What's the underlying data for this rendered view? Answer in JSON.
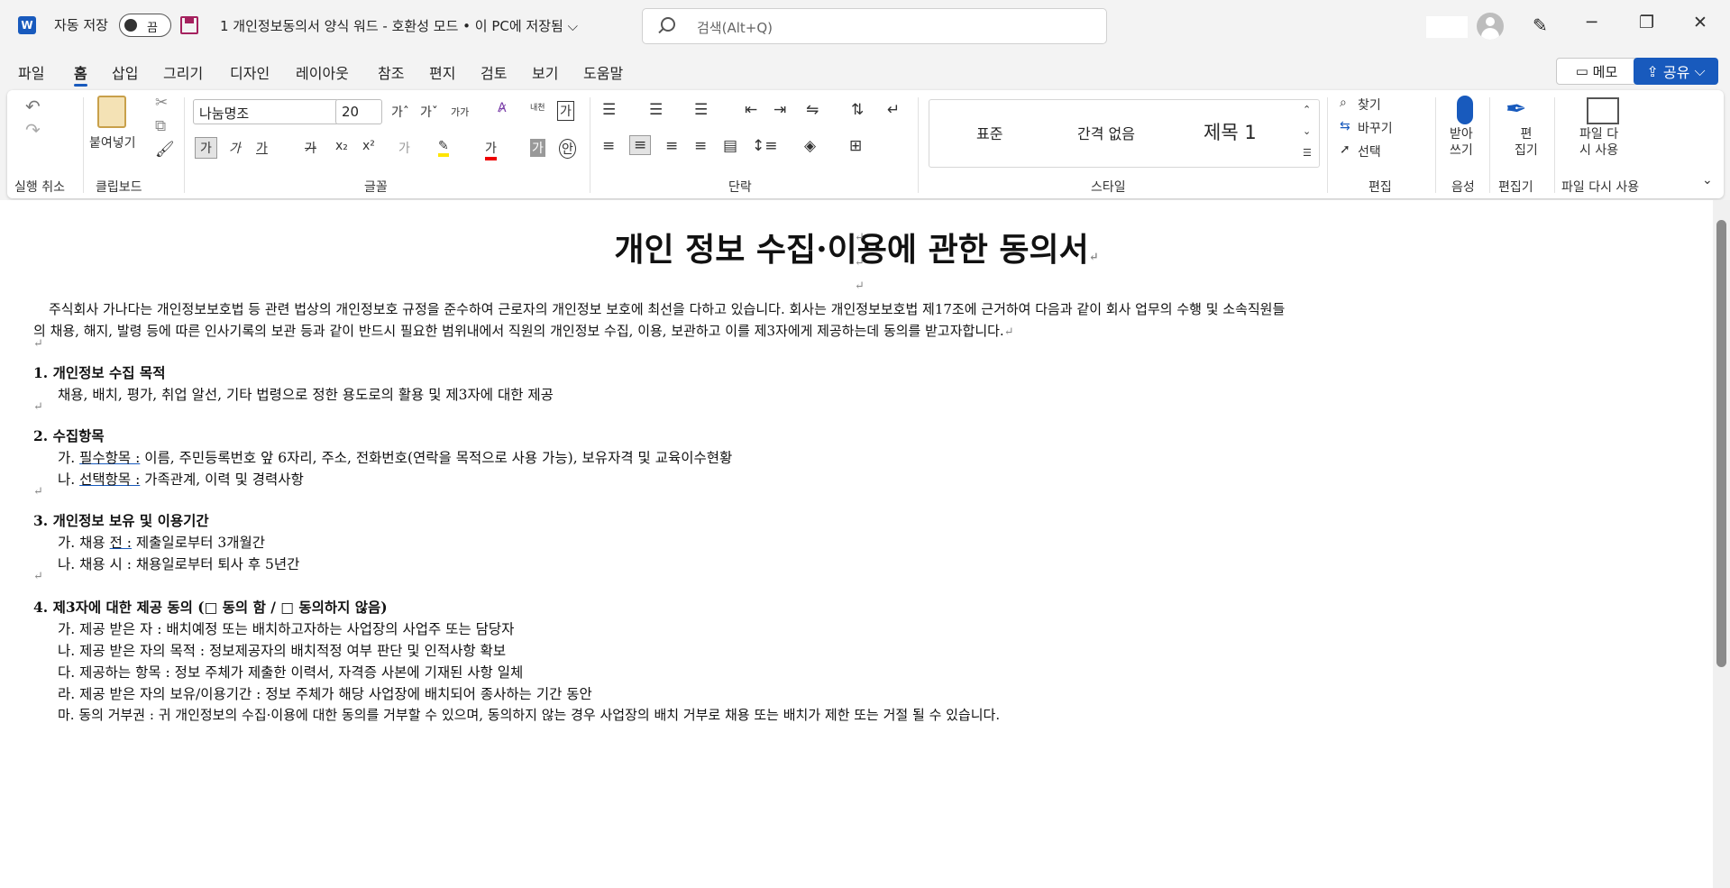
{
  "titlebar": {
    "autosave": "자동 저장",
    "toggle": "끔",
    "doc_title": "1 개인정보동의서 양식 워드 - 호환성 모드 • 이 PC에 저장됨 ⌵",
    "search_placeholder": "검색(Alt+Q)",
    "minimize": "─",
    "restore": "❐",
    "close": "✕"
  },
  "tabs": [
    "파일",
    "홈",
    "삽입",
    "그리기",
    "디자인",
    "레이아웃",
    "참조",
    "편지",
    "검토",
    "보기",
    "도움말"
  ],
  "memo": "메모",
  "share": "공유",
  "ribbon": {
    "groups": {
      "undo": "실행 취소",
      "clipboard": "클립보드",
      "font": "글꼴",
      "paragraph": "단락",
      "styles": "스타일",
      "editing": "편집",
      "voice": "음성",
      "editor": "편집기",
      "reuse": "파일 다시 사용"
    },
    "paste": "붙여넣기",
    "font_name": "나눔명조",
    "font_size": "20",
    "styles": [
      "표준",
      "간격 없음",
      "제목 1"
    ],
    "find": "찾기",
    "replace": "바꾸기",
    "select": "선택",
    "dictate": "받아\n쓰기",
    "editor_btn": "편\n집기",
    "reuse_btn": "파일 다\n시 사용"
  },
  "document": {
    "title": "개인 정보 수집·이용에 관한 동의서",
    "intro1": "주식회사 가나다는 개인정보보호법 등 관련 법상의 개인정보호 규정을 준수하여 근로자의 개인정보 보호에 최선을 다하고 있습니다. 회사는 개인정보보호법 제17조에 근거하여 다음과 같이 회사 업무의 수행 및 소속직원들",
    "intro2": "의 채용, 해지, 발령 등에 따른 인사기록의 보관 등과 같이 반드시 필요한 범위내에서 직원의 개인정보 수집, 이용, 보관하고 이를 제3자에게 제공하는데 동의를 받고자합니다.",
    "s1": "1. 개인정보 수집 목적",
    "s1a": "채용, 배치, 평가, 취업 알선, 기타 법령으로 정한 용도로의 활용 및 제3자에 대한 제공",
    "s2": "2. 수집항목",
    "s2a_pre": "가. ",
    "s2a_u": "필수항목 :",
    "s2a": " 이름, 주민등록번호 앞 6자리, 주소, 전화번호(연락을 목적으로 사용 가능), 보유자격 및 교육이수현황",
    "s2b_pre": "나. ",
    "s2b_u": "선택항목 :",
    "s2b": " 가족관계, 이력 및 경력사항",
    "s3": "3. 개인정보 보유 및 이용기간",
    "s3a_pre": "가. 채용 ",
    "s3a_u": "전 :",
    "s3a": " 제출일로부터 3개월간",
    "s3b": "나. 채용 시 : 채용일로부터 퇴사 후 5년간",
    "s4": "4. 제3자에 대한 제공 동의 (□ 동의 함 / □ 동의하지 않음)",
    "s4a": "가. 제공 받은 자 : 배치예정 또는 배치하고자하는 사업장의 사업주 또는 담당자",
    "s4b": "나. 제공 받은 자의 목적 : 정보제공자의 배치적정 여부 판단 및 인적사항 확보",
    "s4c": "다. 제공하는 항목 : 정보 주체가 제출한 이력서, 자격증 사본에 기재된 사항 일체",
    "s4d": "라. 제공 받은 자의 보유/이용기간 : 정보 주체가 해당 사업장에 배치되어 종사하는 기간 동안",
    "s4e": "마. 동의 거부권 : 귀 개인정보의 수집·이용에 대한 동의를 거부할 수 있으며, 동의하지 않는 경우 사업장의 배치 거부로 채용 또는 배치가 제한 또는 거절 될 수 있습니다.",
    "pilcrow": "↵"
  }
}
